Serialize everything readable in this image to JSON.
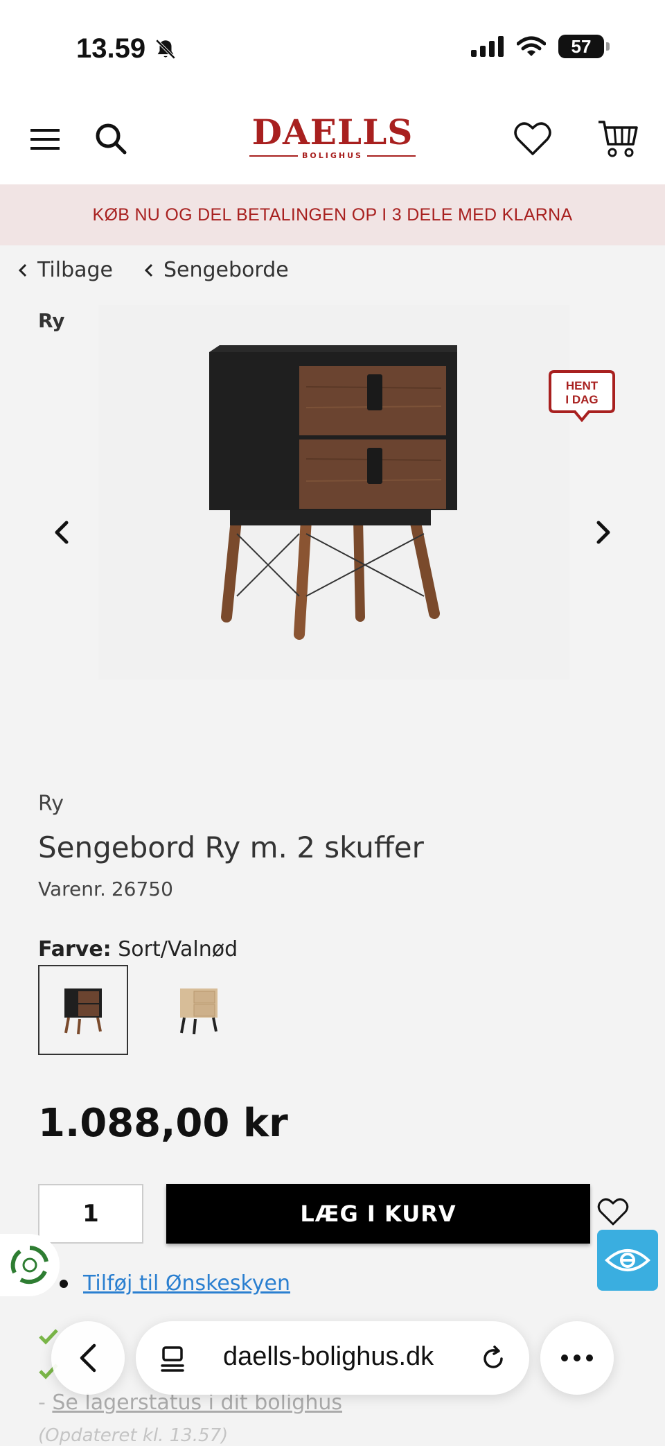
{
  "status_bar": {
    "time": "13.59",
    "battery": "57"
  },
  "header": {
    "logo_main": "DAELLS",
    "logo_sub": "BOLIGHUS"
  },
  "promo": {
    "text": "KØB NU OG DEL BETALINGEN OP I 3 DELE MED KLARNA"
  },
  "breadcrumbs": {
    "back": "Tilbage",
    "category": "Sengeborde"
  },
  "gallery": {
    "brand_tag": "Ry",
    "badge_line1": "HENT",
    "badge_line2": "I DAG"
  },
  "product": {
    "brand": "Ry",
    "title": "Sengebord Ry m. 2 skuffer",
    "sku_label": "Varenr.",
    "sku": "26750",
    "color_label": "Farve:",
    "color_value": "Sort/Valnød",
    "price": "1.088,00 kr"
  },
  "purchase": {
    "quantity": "1",
    "add_to_cart": "LÆG I KURV",
    "wishlist_link": "Tilføj til Ønskeskyen"
  },
  "stock": {
    "lager_link": "Se lagerstatus i dit bolighus",
    "updated": "(Opdateret kl. 13.57)"
  },
  "browser": {
    "url": "daells-bolighus.dk"
  },
  "colors": {
    "brand_red": "#a8201f",
    "promo_bg": "#f1e4e4",
    "link_blue": "#2a7fd0",
    "accessibility_blue": "#3aaee0",
    "check_green": "#7ab648"
  }
}
